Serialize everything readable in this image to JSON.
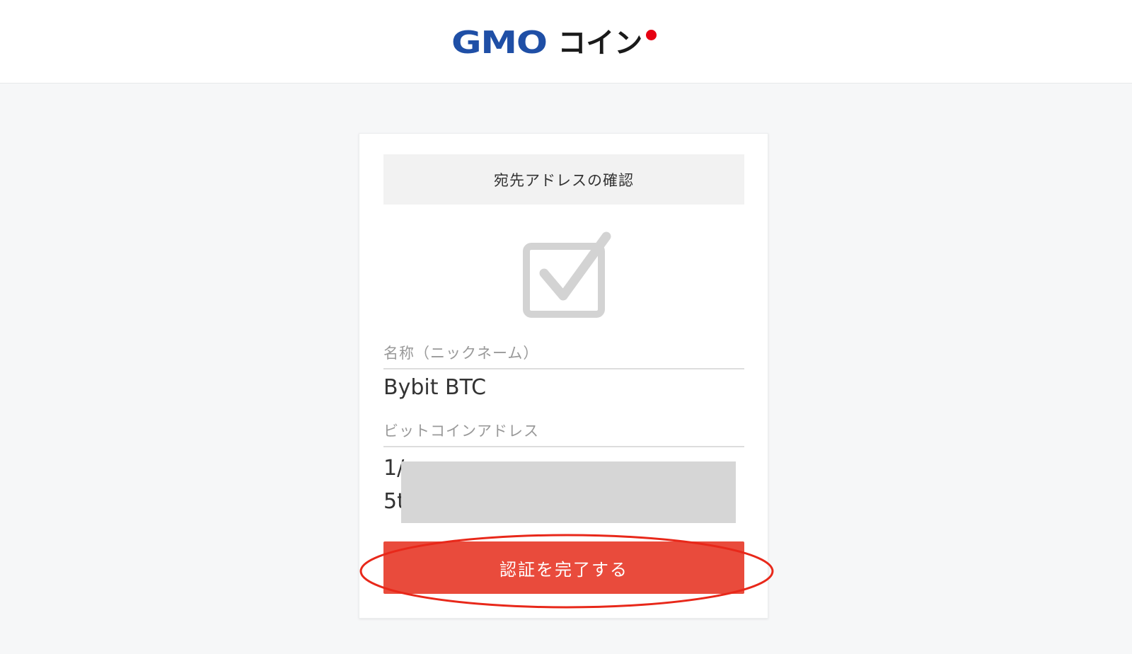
{
  "header": {
    "logo_text_primary": "GMO",
    "logo_text_secondary": "コイン"
  },
  "card": {
    "title": "宛先アドレスの確認",
    "status_icon": "checkbox-checked-icon",
    "nickname_label": "名称（ニックネーム）",
    "nickname_value": "Bybit BTC",
    "address_label": "ビットコインアドレス",
    "address_line1_visible": "1/",
    "address_line2_visible": "5t",
    "submit_label": "認証を完了する"
  },
  "colors": {
    "brand_blue": "#1f4fa6",
    "brand_red_dot": "#e60012",
    "submit_button": "#e94b3c",
    "annotation_red": "#e8281a"
  }
}
